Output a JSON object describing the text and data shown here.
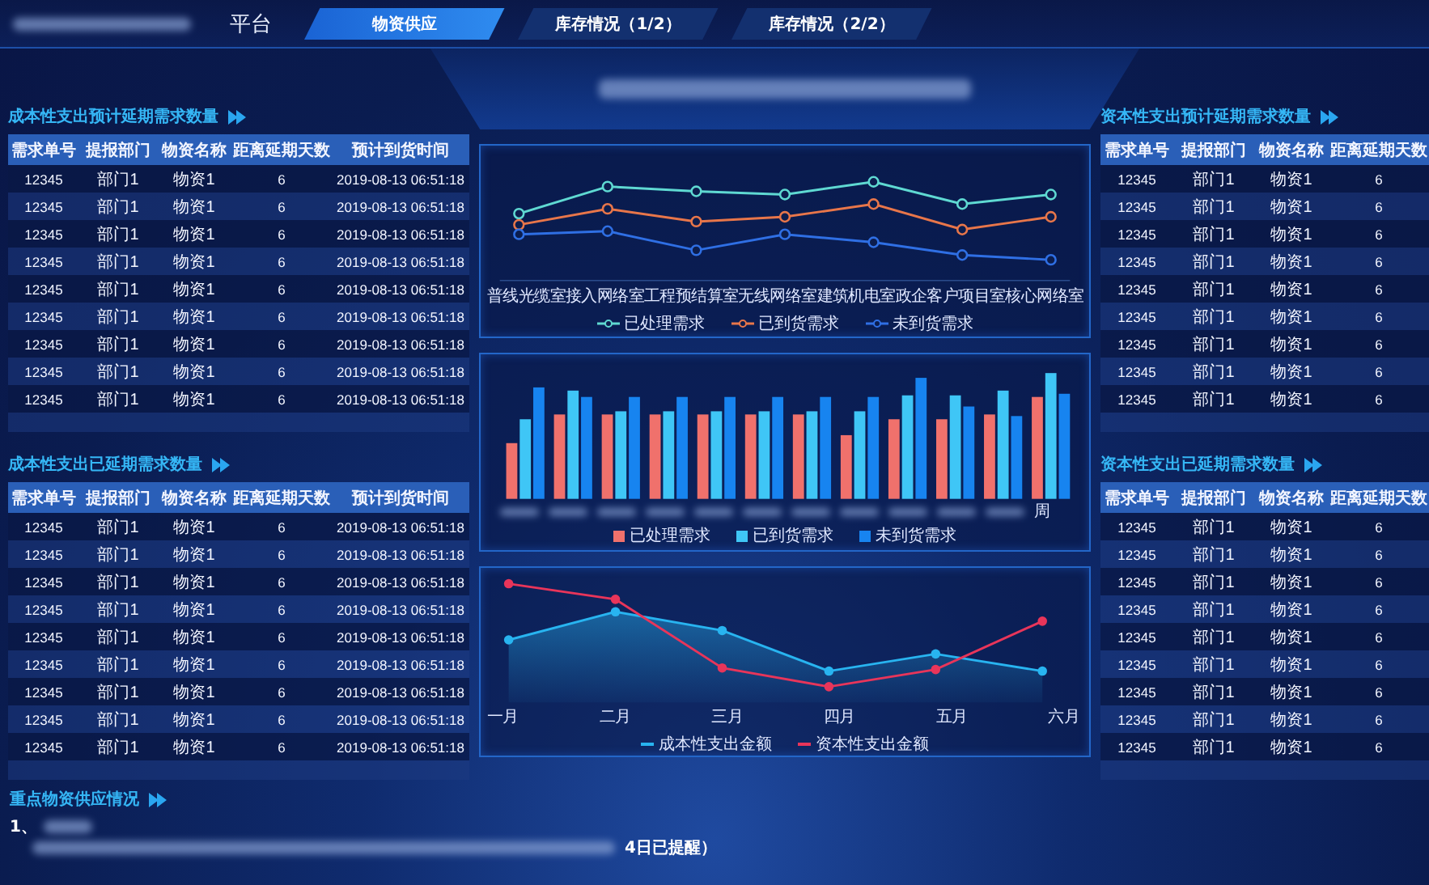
{
  "header": {
    "title": "平台",
    "tabs": [
      {
        "label": "物资供应",
        "selected": true
      },
      {
        "label": "库存情况（1/2）",
        "selected": false
      },
      {
        "label": "库存情况（2/2）",
        "selected": false
      }
    ]
  },
  "left_panels": [
    {
      "title": "成本性支出预计延期需求数量",
      "columns": [
        "需求单号",
        "提报部门",
        "物资名称",
        "距离延期天数",
        "预计到货时间"
      ],
      "rows": [
        [
          "12345",
          "部门1",
          "物资1",
          "6",
          "2019-08-13 06:51:18"
        ],
        [
          "12345",
          "部门1",
          "物资1",
          "6",
          "2019-08-13 06:51:18"
        ],
        [
          "12345",
          "部门1",
          "物资1",
          "6",
          "2019-08-13 06:51:18"
        ],
        [
          "12345",
          "部门1",
          "物资1",
          "6",
          "2019-08-13 06:51:18"
        ],
        [
          "12345",
          "部门1",
          "物资1",
          "6",
          "2019-08-13 06:51:18"
        ],
        [
          "12345",
          "部门1",
          "物资1",
          "6",
          "2019-08-13 06:51:18"
        ],
        [
          "12345",
          "部门1",
          "物资1",
          "6",
          "2019-08-13 06:51:18"
        ],
        [
          "12345",
          "部门1",
          "物资1",
          "6",
          "2019-08-13 06:51:18"
        ],
        [
          "12345",
          "部门1",
          "物资1",
          "6",
          "2019-08-13 06:51:18"
        ]
      ]
    },
    {
      "title": "成本性支出已延期需求数量",
      "columns": [
        "需求单号",
        "提报部门",
        "物资名称",
        "距离延期天数",
        "预计到货时间"
      ],
      "rows": [
        [
          "12345",
          "部门1",
          "物资1",
          "6",
          "2019-08-13 06:51:18"
        ],
        [
          "12345",
          "部门1",
          "物资1",
          "6",
          "2019-08-13 06:51:18"
        ],
        [
          "12345",
          "部门1",
          "物资1",
          "6",
          "2019-08-13 06:51:18"
        ],
        [
          "12345",
          "部门1",
          "物资1",
          "6",
          "2019-08-13 06:51:18"
        ],
        [
          "12345",
          "部门1",
          "物资1",
          "6",
          "2019-08-13 06:51:18"
        ],
        [
          "12345",
          "部门1",
          "物资1",
          "6",
          "2019-08-13 06:51:18"
        ],
        [
          "12345",
          "部门1",
          "物资1",
          "6",
          "2019-08-13 06:51:18"
        ],
        [
          "12345",
          "部门1",
          "物资1",
          "6",
          "2019-08-13 06:51:18"
        ],
        [
          "12345",
          "部门1",
          "物资1",
          "6",
          "2019-08-13 06:51:18"
        ]
      ]
    }
  ],
  "charts": [
    {
      "kind": "line",
      "categories": [
        "普线光缆室",
        "接入网络室",
        "工程预结算室",
        "无线网络室",
        "建筑机电室",
        "政企客户项目室",
        "核心网络室"
      ],
      "legend": [
        {
          "label": "已处理需求",
          "color": "#5fd9d2"
        },
        {
          "label": "已到货需求",
          "color": "#e8764a"
        },
        {
          "label": "未到货需求",
          "color": "#2f6fe4"
        }
      ]
    },
    {
      "kind": "bar",
      "axis_fragment": "周",
      "legend": [
        {
          "label": "已处理需求",
          "color": "#f0716c"
        },
        {
          "label": "已到货需求",
          "color": "#3fc6f6"
        },
        {
          "label": "未到货需求",
          "color": "#1784f0"
        }
      ]
    },
    {
      "kind": "area",
      "categories": [
        "一月",
        "二月",
        "三月",
        "四月",
        "五月",
        "六月"
      ],
      "legend": [
        {
          "label": "成本性支出金额",
          "color": "#28b4f0"
        },
        {
          "label": "资本性支出金额",
          "color": "#e8355a"
        }
      ]
    }
  ],
  "right_panels": [
    {
      "title": "资本性支出预计延期需求数量",
      "columns": [
        "需求单号",
        "提报部门",
        "物资名称",
        "距离延期天数"
      ],
      "rows": [
        [
          "12345",
          "部门1",
          "物资1",
          "6"
        ],
        [
          "12345",
          "部门1",
          "物资1",
          "6"
        ],
        [
          "12345",
          "部门1",
          "物资1",
          "6"
        ],
        [
          "12345",
          "部门1",
          "物资1",
          "6"
        ],
        [
          "12345",
          "部门1",
          "物资1",
          "6"
        ],
        [
          "12345",
          "部门1",
          "物资1",
          "6"
        ],
        [
          "12345",
          "部门1",
          "物资1",
          "6"
        ],
        [
          "12345",
          "部门1",
          "物资1",
          "6"
        ],
        [
          "12345",
          "部门1",
          "物资1",
          "6"
        ]
      ]
    },
    {
      "title": "资本性支出已延期需求数量",
      "columns": [
        "需求单号",
        "提报部门",
        "物资名称",
        "距离延期天数"
      ],
      "rows": [
        [
          "12345",
          "部门1",
          "物资1",
          "6"
        ],
        [
          "12345",
          "部门1",
          "物资1",
          "6"
        ],
        [
          "12345",
          "部门1",
          "物资1",
          "6"
        ],
        [
          "12345",
          "部门1",
          "物资1",
          "6"
        ],
        [
          "12345",
          "部门1",
          "物资1",
          "6"
        ],
        [
          "12345",
          "部门1",
          "物资1",
          "6"
        ],
        [
          "12345",
          "部门1",
          "物资1",
          "6"
        ],
        [
          "12345",
          "部门1",
          "物资1",
          "6"
        ],
        [
          "12345",
          "部门1",
          "物资1",
          "6"
        ]
      ]
    }
  ],
  "bottom": {
    "title": "重点物资供应情况",
    "item_number": "1、",
    "note_tail": "4日已提醒）"
  }
}
